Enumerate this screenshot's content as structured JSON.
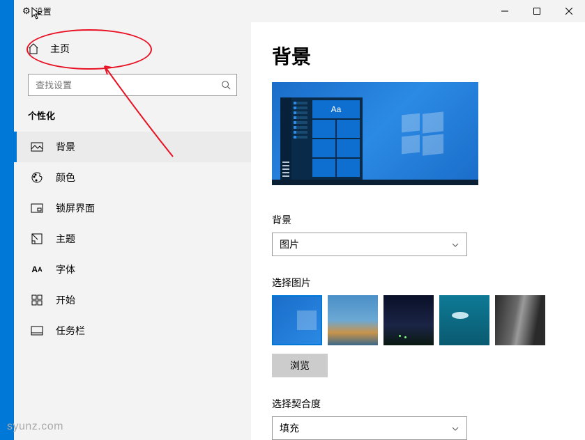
{
  "window": {
    "title": "设置"
  },
  "sidebar": {
    "home_label": "主页",
    "search_placeholder": "查找设置",
    "section_title": "个性化",
    "items": [
      {
        "label": "背景",
        "icon": "picture-icon",
        "selected": true
      },
      {
        "label": "颜色",
        "icon": "palette-icon",
        "selected": false
      },
      {
        "label": "锁屏界面",
        "icon": "lockscreen-icon",
        "selected": false
      },
      {
        "label": "主题",
        "icon": "theme-icon",
        "selected": false
      },
      {
        "label": "字体",
        "icon": "font-icon",
        "selected": false
      },
      {
        "label": "开始",
        "icon": "start-icon",
        "selected": false
      },
      {
        "label": "任务栏",
        "icon": "taskbar-icon",
        "selected": false
      }
    ]
  },
  "content": {
    "heading": "背景",
    "preview_tile_text": "Aa",
    "background_label": "背景",
    "background_dropdown_value": "图片",
    "choose_picture_label": "选择图片",
    "browse_label": "浏览",
    "fit_label": "选择契合度",
    "fit_dropdown_value": "填充"
  },
  "watermark": "syunz.com",
  "colors": {
    "accent": "#0078d7",
    "annotation": "#e81123"
  }
}
